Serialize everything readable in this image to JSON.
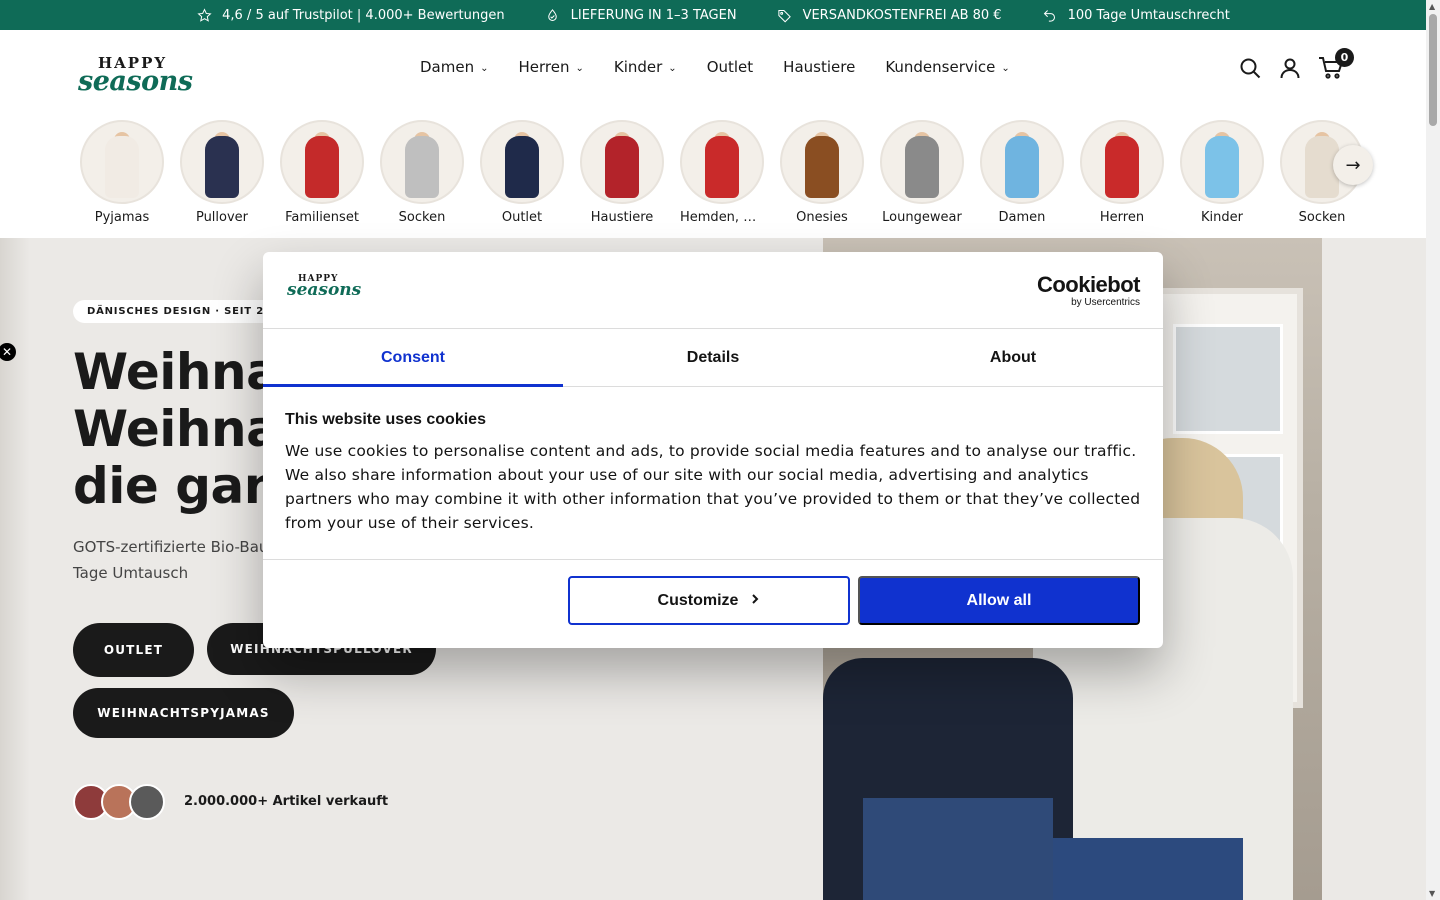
{
  "announcement": {
    "items": [
      {
        "icon": "star-icon",
        "text": "4,6 / 5 auf Trustpilot | 4.000+ Bewertungen"
      },
      {
        "icon": "droplet-icon",
        "text": "LIEFERUNG IN 1–3 TAGEN"
      },
      {
        "icon": "tag-icon",
        "text": "VERSANDKOSTENFREI AB 80 €"
      },
      {
        "icon": "return-arrow-icon",
        "text": "100 Tage Umtauschrecht"
      }
    ],
    "background": "#0f6b57"
  },
  "header": {
    "logo_top": "HAPPY",
    "logo_bottom": "seasons",
    "nav": [
      {
        "label": "Damen",
        "dropdown": true
      },
      {
        "label": "Herren",
        "dropdown": true
      },
      {
        "label": "Kinder",
        "dropdown": true
      },
      {
        "label": "Outlet",
        "dropdown": false
      },
      {
        "label": "Haustiere",
        "dropdown": false
      },
      {
        "label": "Kundenservice",
        "dropdown": true
      }
    ],
    "cart_count": "0"
  },
  "categories": [
    {
      "label": "Pyjamas",
      "color": "#f1ebe4"
    },
    {
      "label": "Pullover",
      "color": "#2a3150"
    },
    {
      "label": "Familienset",
      "color": "#c42a2a"
    },
    {
      "label": "Socken",
      "color": "#bfbfbf"
    },
    {
      "label": "Outlet",
      "color": "#1f2a4a"
    },
    {
      "label": "Haustiere",
      "color": "#b3232a"
    },
    {
      "label": "Hemden, An...",
      "color": "#c92a2a"
    },
    {
      "label": "Onesies",
      "color": "#8a4e22"
    },
    {
      "label": "Loungewear",
      "color": "#8a8a8a"
    },
    {
      "label": "Damen",
      "color": "#6fb4e0"
    },
    {
      "label": "Herren",
      "color": "#c92a2a"
    },
    {
      "label": "Kinder",
      "color": "#7cc2e8"
    },
    {
      "label": "Socken",
      "color": "#e5dccf"
    }
  ],
  "hero": {
    "badge": "DÄNISCHES DESIGN · SEIT 2016",
    "title_lines": [
      "Weihnac",
      "Weihnac",
      "die ganz"
    ],
    "subtitle_lines": [
      "GOTS-zertifizierte Bio-Bau",
      "Tage Umtausch"
    ],
    "buttons": {
      "outlet": "OUTLET",
      "pullover": "WEIHNACHTSPULLOVER",
      "pyjamas": "WEIHNACHTSPYJAMAS"
    },
    "sold_text": "2.000.000+ Artikel verkauft"
  },
  "cookie_dialog": {
    "logo_top": "HAPPY",
    "logo_bottom": "seasons",
    "brand": "Cookiebot",
    "brand_sub": "by Usercentrics",
    "tabs": [
      {
        "label": "Consent",
        "active": true
      },
      {
        "label": "Details",
        "active": false
      },
      {
        "label": "About",
        "active": false
      }
    ],
    "title": "This website uses cookies",
    "text": "We use cookies to personalise content and ads, to provide social media features and to analyse our traffic. We also share information about your use of our site with our social media, advertising and analytics partners who may combine it with other information that you’ve provided to them or that they’ve collected from your use of their services.",
    "customize_label": "Customize",
    "allow_label": "Allow all",
    "accent": "#1032cf"
  }
}
